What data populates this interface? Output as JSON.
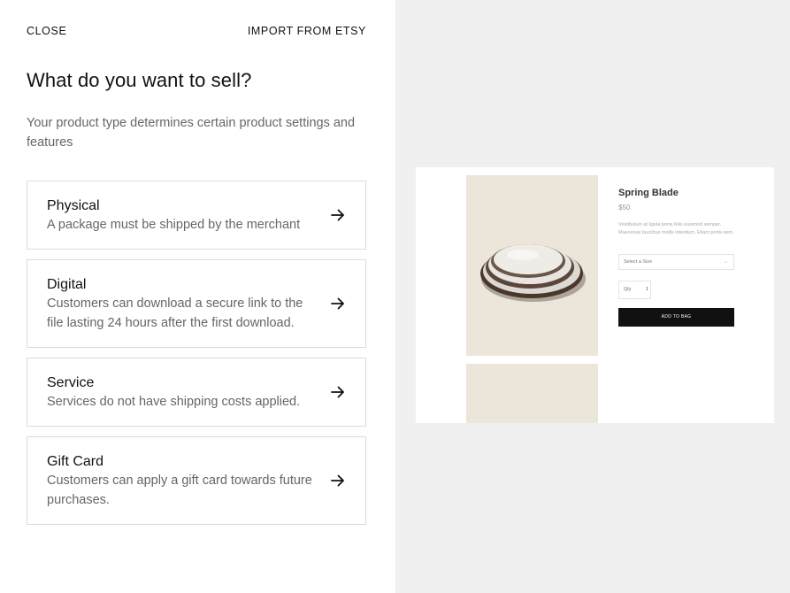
{
  "header": {
    "close_label": "CLOSE",
    "import_label": "IMPORT FROM ETSY"
  },
  "main": {
    "title": "What do you want to sell?",
    "subtitle": "Your product type determines certain product settings and features",
    "options": [
      {
        "title": "Physical",
        "description": "A package must be shipped by the merchant",
        "icon": "arrow-right-icon"
      },
      {
        "title": "Digital",
        "description": "Customers can download a secure link to the file lasting 24 hours after the first download.",
        "icon": "arrow-right-icon"
      },
      {
        "title": "Service",
        "description": "Services do not have shipping costs applied.",
        "icon": "arrow-right-icon"
      },
      {
        "title": "Gift Card",
        "description": "Customers can apply a gift card towards future purchases.",
        "icon": "arrow-right-icon"
      }
    ]
  },
  "preview": {
    "product_title": "Spring Blade",
    "price": "$50",
    "description": "Vestibulum at ligula porta felis euismod semper. Maecenas faucibus mollis interdum. Etiam porta sem.",
    "select_label": "Select a Size",
    "qty_label": "Qty",
    "qty_value": "1",
    "add_button": "ADD TO BAG"
  },
  "colors": {
    "panel_bg": "#f0f0f0",
    "image_bg": "#ece5da",
    "card_border": "#dcdcdc",
    "button_bg": "#111111"
  }
}
